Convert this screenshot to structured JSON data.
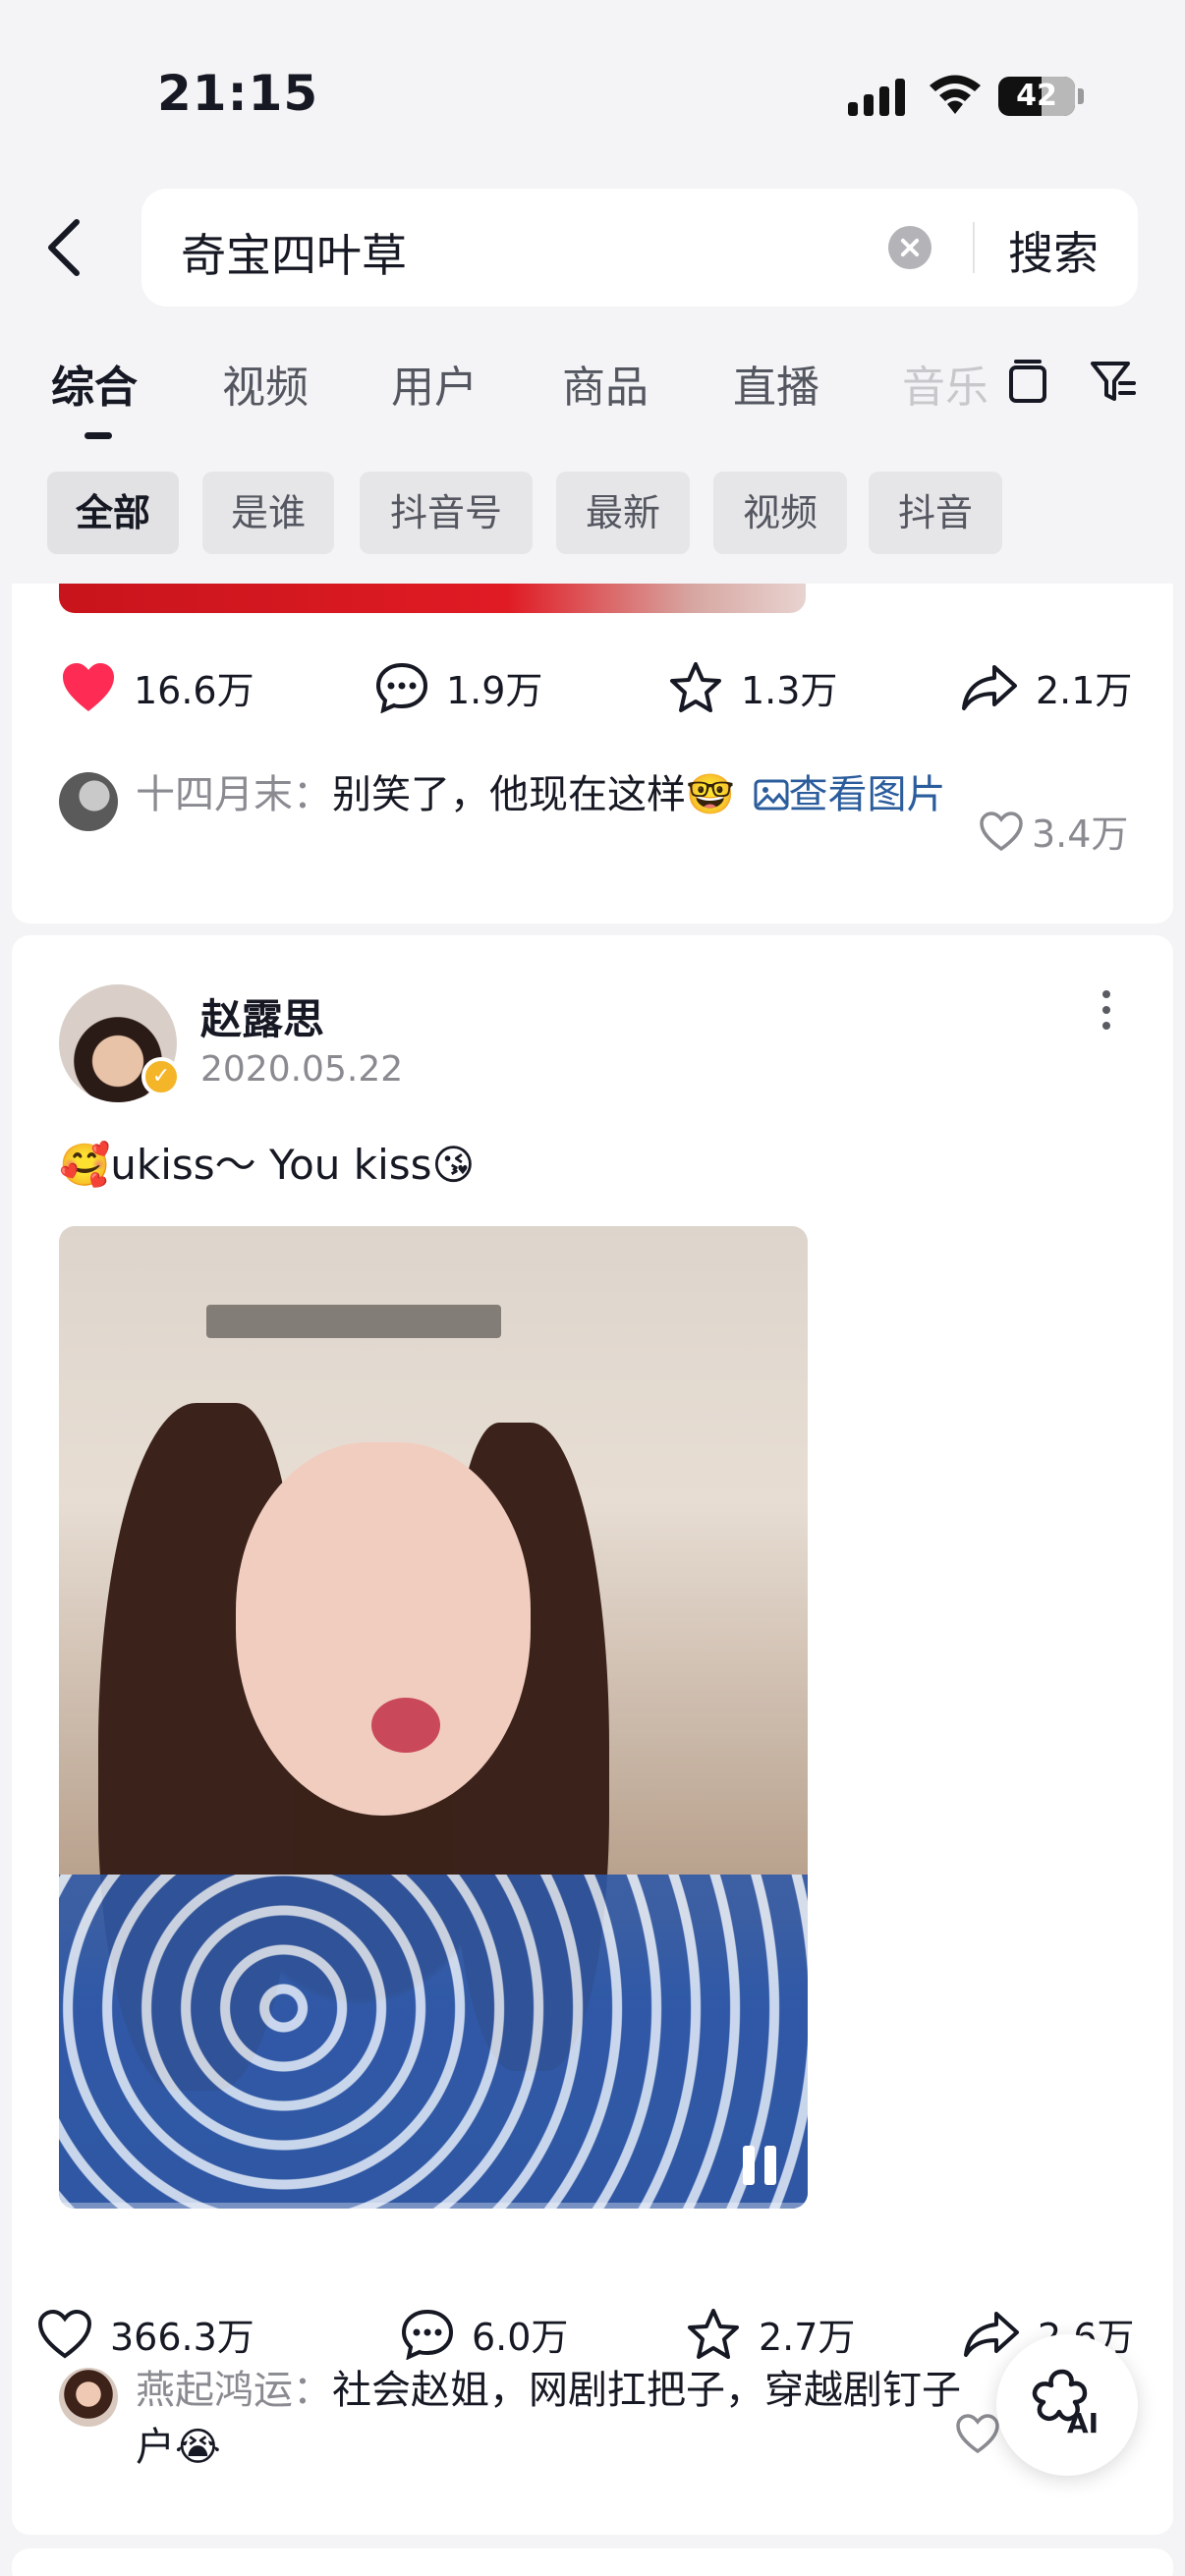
{
  "status_bar": {
    "time": "21:15",
    "battery": "42"
  },
  "search": {
    "query": "奇宝四叶草",
    "button": "搜索"
  },
  "tabs": [
    {
      "label": "综合"
    },
    {
      "label": "视频"
    },
    {
      "label": "用户"
    },
    {
      "label": "商品"
    },
    {
      "label": "直播"
    },
    {
      "label": "音乐"
    }
  ],
  "filters": [
    "全部",
    "是谁",
    "抖音号",
    "最新",
    "视频",
    "抖音"
  ],
  "posts": [
    {
      "stats": {
        "likes": "16.6万",
        "comments": "1.9万",
        "favorites": "1.3万",
        "shares": "2.1万"
      },
      "top_comment": {
        "user": "十四月末：",
        "text": "别笑了，他现在这样🤓",
        "link_label": "查看图片",
        "likes": "3.4万"
      }
    },
    {
      "author": "赵露思",
      "date": "2020.05.22",
      "caption": "🥰ukiss～ You kiss😘",
      "stats": {
        "likes": "366.3万",
        "comments": "6.0万",
        "favorites": "2.7万",
        "shares": "2.6万"
      },
      "top_comment": {
        "user": "燕起鸿运：",
        "text": "社会赵姐，网剧扛把子，穿越剧钉子户😭"
      }
    }
  ],
  "ai_button": "AI",
  "colors": {
    "accent_red": "#fe2c55",
    "link_blue": "#2b5c9c",
    "verify_gold": "#f4b529"
  }
}
